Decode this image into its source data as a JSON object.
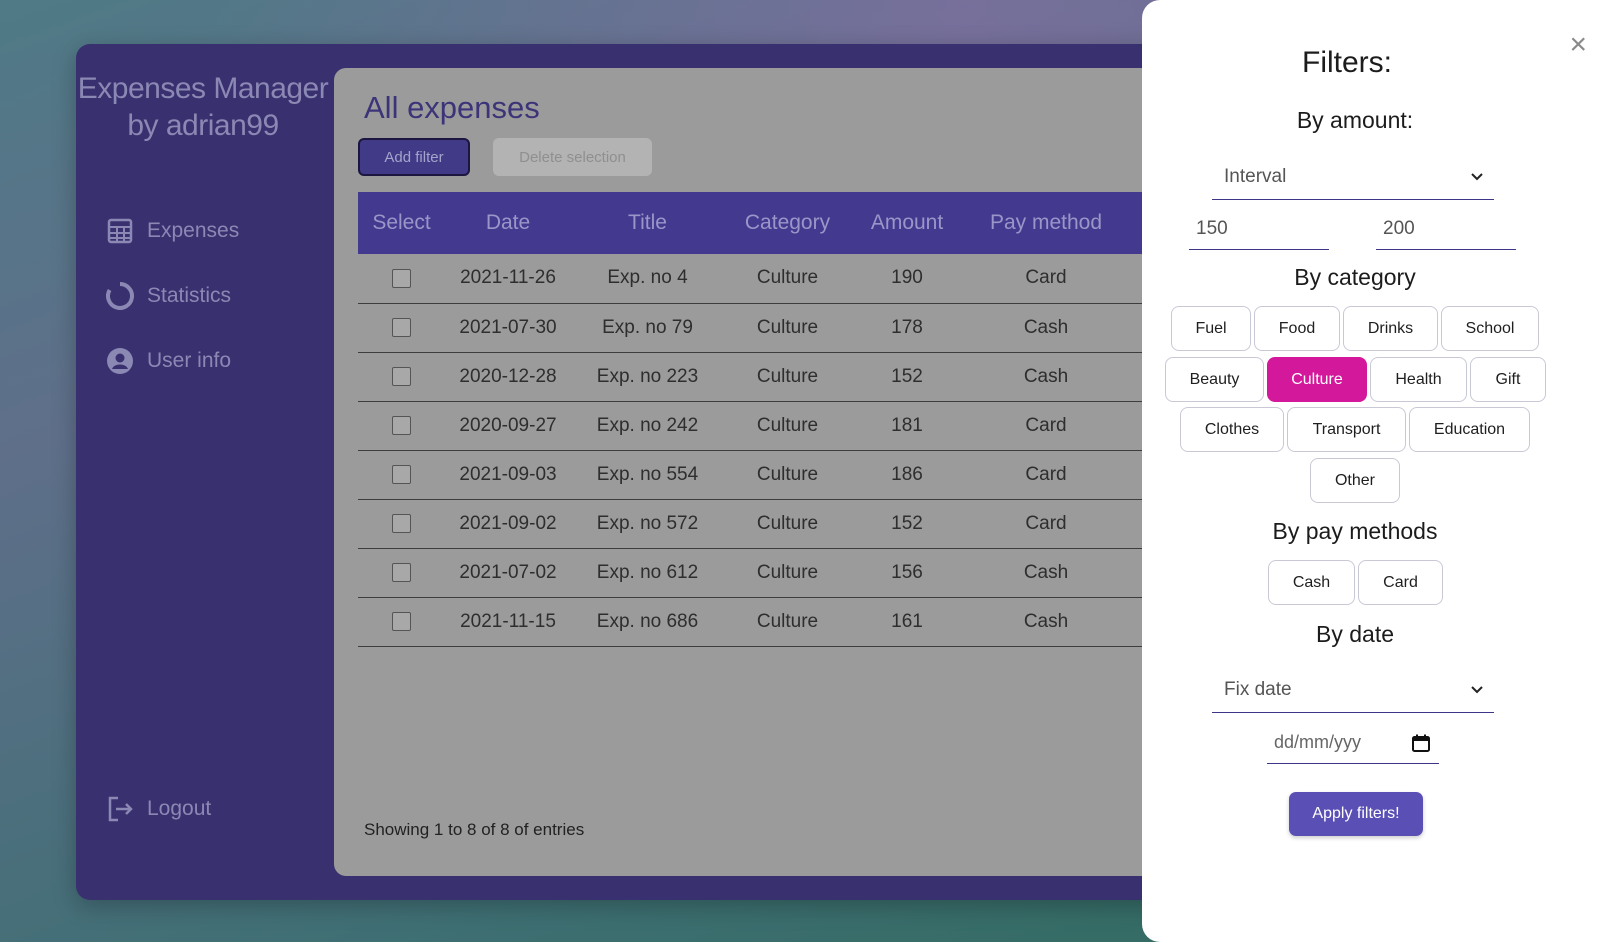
{
  "sidebar": {
    "brand": "Expenses Manager by adrian99",
    "items": [
      {
        "label": "Expenses",
        "icon": "table-icon"
      },
      {
        "label": "Statistics",
        "icon": "pie-chart-icon"
      },
      {
        "label": "User info",
        "icon": "user-icon"
      }
    ],
    "logout": "Logout"
  },
  "main": {
    "title": "All expenses",
    "add_filter": "Add filter",
    "delete_selection": "Delete selection",
    "columns": [
      "Select",
      "Date",
      "Title",
      "Category",
      "Amount",
      "Pay method"
    ],
    "rows": [
      {
        "date": "2021-11-26",
        "title": "Exp. no 4",
        "category": "Culture",
        "amount": "190",
        "pay": "Card"
      },
      {
        "date": "2021-07-30",
        "title": "Exp. no 79",
        "category": "Culture",
        "amount": "178",
        "pay": "Cash"
      },
      {
        "date": "2020-12-28",
        "title": "Exp. no 223",
        "category": "Culture",
        "amount": "152",
        "pay": "Cash"
      },
      {
        "date": "2020-09-27",
        "title": "Exp. no 242",
        "category": "Culture",
        "amount": "181",
        "pay": "Card"
      },
      {
        "date": "2021-09-03",
        "title": "Exp. no 554",
        "category": "Culture",
        "amount": "186",
        "pay": "Card"
      },
      {
        "date": "2021-09-02",
        "title": "Exp. no 572",
        "category": "Culture",
        "amount": "152",
        "pay": "Card"
      },
      {
        "date": "2021-07-02",
        "title": "Exp. no 612",
        "category": "Culture",
        "amount": "156",
        "pay": "Cash"
      },
      {
        "date": "2021-11-15",
        "title": "Exp. no 686",
        "category": "Culture",
        "amount": "161",
        "pay": "Cash"
      }
    ],
    "footer": "Showing 1 to 8 of 8 of entries"
  },
  "filters": {
    "title": "Filters:",
    "by_amount": "By amount:",
    "amount_mode": "Interval",
    "amount_min": "150",
    "amount_max": "200",
    "by_category": "By category",
    "categories": [
      "Fuel",
      "Food",
      "Drinks",
      "School",
      "Beauty",
      "Culture",
      "Health",
      "Gift",
      "Clothes",
      "Transport",
      "Education",
      "Other"
    ],
    "selected_category": "Culture",
    "by_pay": "By pay methods",
    "pay_methods": [
      "Cash",
      "Card"
    ],
    "by_date": "By date",
    "date_mode": "Fix date",
    "date_placeholder": "dd/mm/yyy",
    "apply": "Apply filters!",
    "close": "×"
  },
  "colors": {
    "accent": "#5a4fb5",
    "selected_chip": "#d3189b",
    "sidebar_bg": "#39306f",
    "table_header": "#433a8f"
  }
}
